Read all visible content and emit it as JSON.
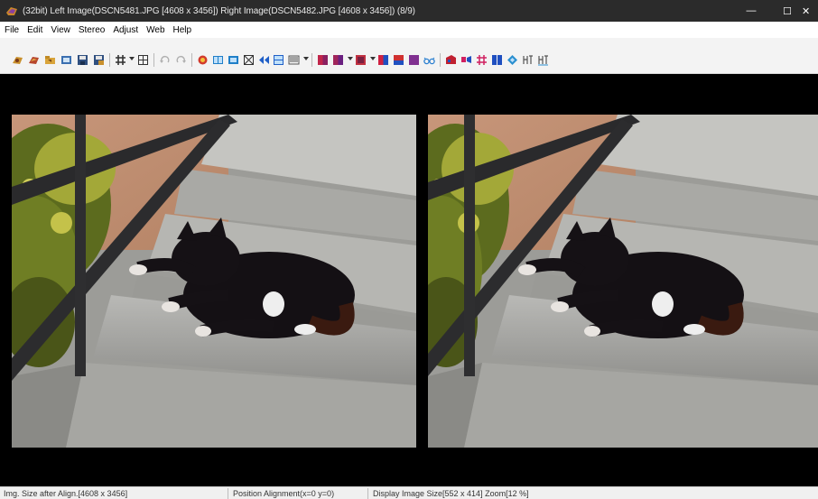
{
  "window": {
    "title": "(32bit) Left Image(DSCN5481.JPG [4608 x 3456]) Right Image(DSCN5482.JPG [4608 x 3456])  (8/9)",
    "controls": {
      "minimize": "—",
      "maximize": "☐",
      "close": "✕"
    }
  },
  "menu": {
    "items": [
      "File",
      "Edit",
      "View",
      "Stereo",
      "Adjust",
      "Web",
      "Help"
    ]
  },
  "toolbar": {
    "buttons": [
      {
        "name": "open-stereo-icon",
        "color": "#c9902c"
      },
      {
        "name": "open-multi-icon",
        "color": "#b7462c"
      },
      {
        "name": "open-folder-icon",
        "color": "#d9a43a"
      },
      {
        "name": "open-video-icon",
        "color": "#3a6fb0"
      },
      {
        "name": "save-icon",
        "color": "#2f4f7f"
      },
      {
        "name": "save-as-icon",
        "color": "#2f4f7f"
      },
      {
        "name": "auto-align-icon",
        "color": "#333333"
      },
      {
        "name": "grid-icon",
        "color": "#333333"
      },
      {
        "name": "undo-icon",
        "color": "#b0b0b0"
      },
      {
        "name": "redo-icon",
        "color": "#b0b0b0"
      },
      {
        "name": "adjust-color-icon",
        "color": "#d23b2c"
      },
      {
        "name": "side-by-side-icon",
        "color": "#1f7fc8"
      },
      {
        "name": "single-image-icon",
        "color": "#1f7fc8"
      },
      {
        "name": "crop-icon",
        "color": "#333333"
      },
      {
        "name": "swap-icon",
        "color": "#1f5fc8"
      },
      {
        "name": "overunder-icon",
        "color": "#1f5fc8"
      },
      {
        "name": "interlaced-icon",
        "color": "#555555"
      },
      {
        "name": "anaglyph-red-cyan-icon",
        "color": "#c0254a"
      },
      {
        "name": "anaglyph-gray-icon",
        "color": "#a0255a"
      },
      {
        "name": "anaglyph-dubois-icon",
        "color": "#c03040"
      },
      {
        "name": "anaglyph-color-icon",
        "color": "#2050c0"
      },
      {
        "name": "anaglyph-yellow-blue-icon",
        "color": "#d03030"
      },
      {
        "name": "anaglyph-green-magenta-icon",
        "color": "#803090"
      },
      {
        "name": "glasses-icon",
        "color": "#2a7fd0"
      },
      {
        "name": "stereo-card-icon",
        "color": "#c02030"
      },
      {
        "name": "wiggle-icon",
        "color": "#d02060"
      },
      {
        "name": "grid-hash-icon",
        "color": "#d02060"
      },
      {
        "name": "columns-icon",
        "color": "#1f4fc0"
      },
      {
        "name": "diamond-icon",
        "color": "#2a8fd0"
      },
      {
        "name": "html-export-icon",
        "color": "#555555"
      },
      {
        "name": "html-web-icon",
        "color": "#555555"
      }
    ]
  },
  "images": {
    "left_label": "DSCN5481.JPG",
    "right_label": "DSCN5482.JPG"
  },
  "status": {
    "size_after_align": "Img. Size after Align.[4608 x 3456]",
    "position_alignment": "Position Alignment(x=0 y=0)",
    "display_size": "Display Image Size[552 x 414]  Zoom[12 %]"
  }
}
